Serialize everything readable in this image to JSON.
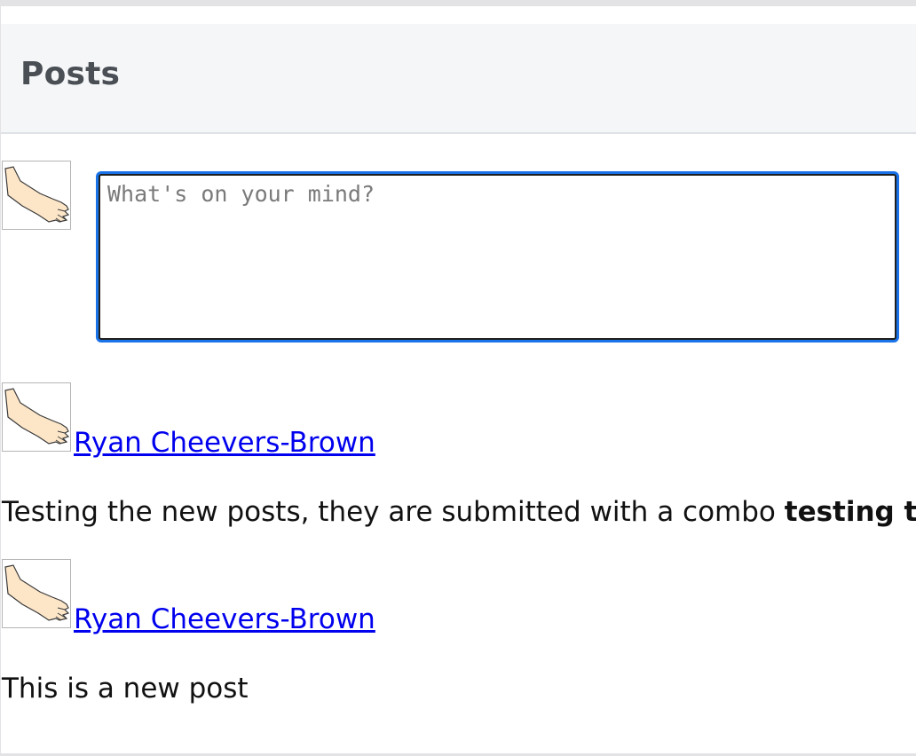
{
  "header": {
    "title": "Posts"
  },
  "composer": {
    "placeholder": "What's on your mind?",
    "value": ""
  },
  "posts": [
    {
      "author": "Ryan Cheevers-Brown",
      "body_plain": "Testing the new posts, they are submitted with a combo ",
      "body_bold": "testing text"
    },
    {
      "author": "Ryan Cheevers-Brown",
      "body_plain": "This is a new post",
      "body_bold": ""
    }
  ],
  "icons": {
    "avatar": "arm-avatar-icon"
  },
  "colors": {
    "link": "#0000ee",
    "focus_ring": "#1a73e8",
    "header_bg": "#f5f6f8"
  }
}
